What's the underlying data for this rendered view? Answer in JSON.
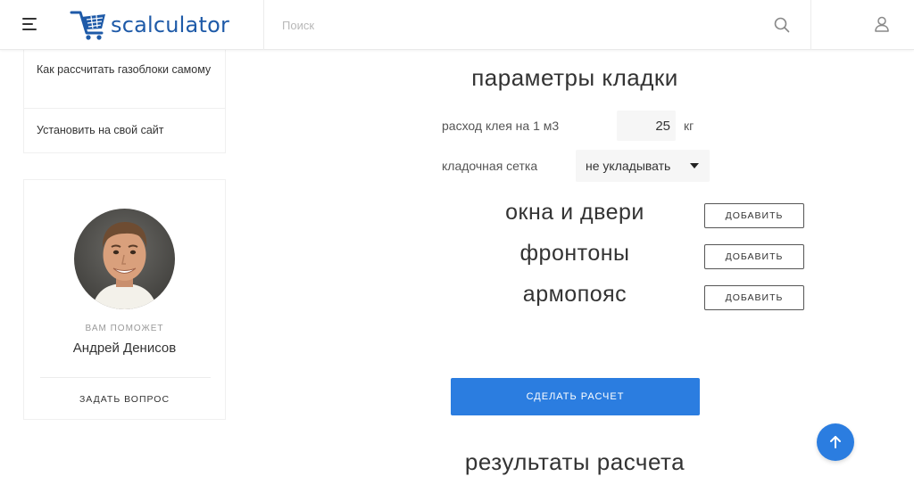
{
  "header": {
    "logo_text": "scalculator",
    "search_placeholder": "Поиск",
    "icons": {
      "menu": "hamburger-icon",
      "search": "search-icon",
      "user": "user-icon"
    }
  },
  "sidebar": {
    "menu_items": [
      {
        "label": "Как рассчитать газоблоки самому"
      },
      {
        "label": "Установить на свой сайт"
      }
    ],
    "helper": {
      "caption": "ВАМ ПОМОЖЕТ",
      "name": "Андрей Денисов",
      "ask_label": "ЗАДАТЬ ВОПРОС"
    }
  },
  "main": {
    "params_title": "параметры кладки",
    "glue": {
      "label": "расход клея на 1 м3",
      "value": "25",
      "unit": "кг"
    },
    "mesh": {
      "label": "кладочная сетка",
      "selected": "не укладывать"
    },
    "extras": [
      {
        "label": "окна и двери",
        "button": "ДОБАВИТЬ"
      },
      {
        "label": "фронтоны",
        "button": "ДОБАВИТЬ"
      },
      {
        "label": "армопояс",
        "button": "ДОБАВИТЬ"
      }
    ],
    "calculate_button": "СДЕЛАТЬ РАСЧЕТ",
    "results_title": "результаты расчета"
  },
  "colors": {
    "accent": "#2b7de0",
    "logo": "#1e5aa8",
    "text": "#333333"
  }
}
